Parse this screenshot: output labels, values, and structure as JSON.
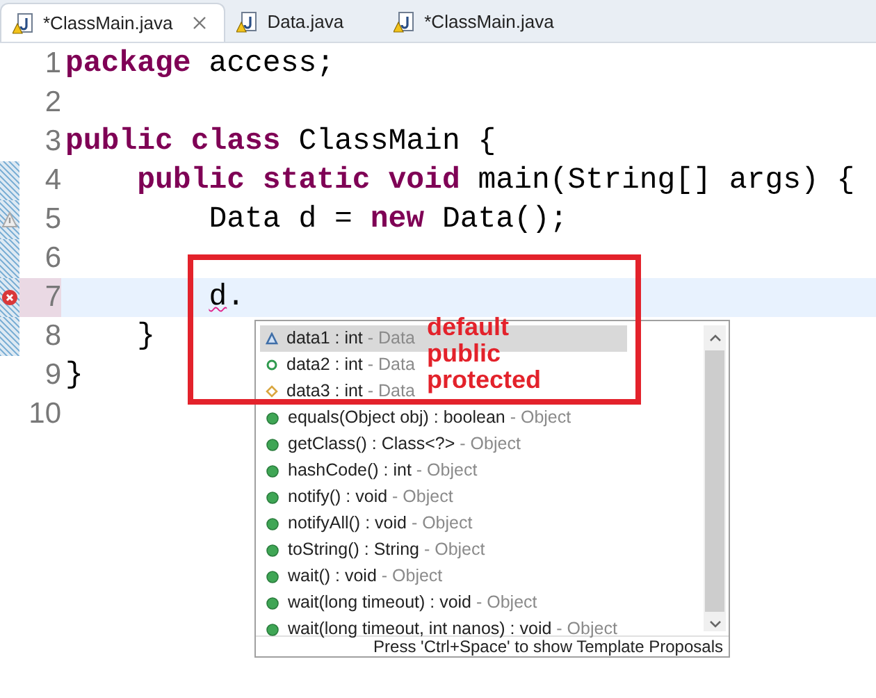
{
  "tabs": [
    {
      "label": "*ClassMain.java",
      "selected": true,
      "closable": true
    },
    {
      "label": "Data.java",
      "selected": false,
      "closable": false
    },
    {
      "label": "*ClassMain.java",
      "selected": false,
      "closable": false
    }
  ],
  "editor": {
    "lines": [
      {
        "number": "1",
        "warning": false,
        "error": false,
        "changed": false,
        "current": false,
        "tokens": [
          {
            "text": "package",
            "kind": "keyword"
          },
          {
            "text": " access;",
            "kind": "plain"
          }
        ]
      },
      {
        "number": "2",
        "warning": false,
        "error": false,
        "changed": false,
        "current": false
      },
      {
        "number": "3",
        "warning": false,
        "error": false,
        "changed": false,
        "current": false,
        "tokens": [
          {
            "text": "public class",
            "kind": "keyword"
          },
          {
            "text": " ClassMain {",
            "kind": "plain"
          }
        ]
      },
      {
        "number": "4",
        "warning": false,
        "error": false,
        "changed": true,
        "current": false,
        "tokens": [
          {
            "text": "    public static void",
            "kind": "keyword"
          },
          {
            "text": " main(String[] args) {",
            "kind": "plain"
          }
        ]
      },
      {
        "number": "5",
        "warning": true,
        "error": false,
        "changed": true,
        "current": false,
        "tokens": [
          {
            "text": "        Data d = ",
            "kind": "plain"
          },
          {
            "text": "new",
            "kind": "keyword"
          },
          {
            "text": " Data();",
            "kind": "plain"
          }
        ]
      },
      {
        "number": "6",
        "warning": false,
        "error": false,
        "changed": true,
        "current": false
      },
      {
        "number": "7",
        "warning": false,
        "error": true,
        "changed": true,
        "current": true,
        "tokens": [
          {
            "text": "        d",
            "kind": "error"
          },
          {
            "text": ".",
            "kind": "plain"
          }
        ]
      },
      {
        "number": "8",
        "warning": false,
        "error": false,
        "changed": true,
        "current": false,
        "tokens": [
          {
            "text": "    }",
            "kind": "plain"
          }
        ]
      },
      {
        "number": "9",
        "warning": false,
        "error": false,
        "changed": false,
        "current": false,
        "tokens": [
          {
            "text": "}",
            "kind": "plain"
          }
        ]
      },
      {
        "number": "10",
        "warning": false,
        "error": false,
        "changed": false,
        "current": false
      }
    ]
  },
  "completion": {
    "items": [
      {
        "kind": "default",
        "name": "data1 : int",
        "owner": "- Data",
        "selected": true
      },
      {
        "kind": "public",
        "name": "data2 : int",
        "owner": "- Data",
        "selected": false
      },
      {
        "kind": "protected",
        "name": "data3 : int",
        "owner": "- Data",
        "selected": false
      },
      {
        "kind": "method",
        "name": "equals(Object obj) : boolean",
        "owner": "- Object",
        "selected": false
      },
      {
        "kind": "method",
        "name": "getClass() : Class<?>",
        "owner": "- Object",
        "selected": false
      },
      {
        "kind": "method",
        "name": "hashCode() : int",
        "owner": "- Object",
        "selected": false
      },
      {
        "kind": "method",
        "name": "notify() : void",
        "owner": "- Object",
        "selected": false
      },
      {
        "kind": "method",
        "name": "notifyAll() : void",
        "owner": "- Object",
        "selected": false
      },
      {
        "kind": "method",
        "name": "toString() : String",
        "owner": "- Object",
        "selected": false
      },
      {
        "kind": "method",
        "name": "wait() : void",
        "owner": "- Object",
        "selected": false
      },
      {
        "kind": "method",
        "name": "wait(long timeout) : void",
        "owner": "- Object",
        "selected": false
      },
      {
        "kind": "method",
        "name": "wait(long timeout, int nanos) : void",
        "owner": "- Object",
        "selected": false
      }
    ],
    "footer": "Press 'Ctrl+Space' to show Template Proposals"
  },
  "annotation": {
    "labels": [
      "default",
      "public",
      "protected"
    ]
  }
}
